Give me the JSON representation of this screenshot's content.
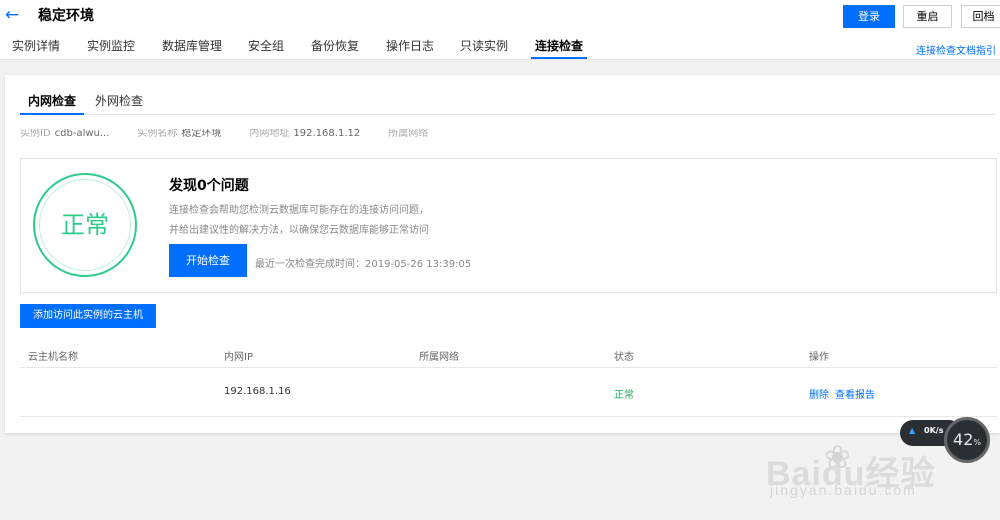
{
  "header": {
    "back_icon": "arrow-left-icon",
    "title": "稳定环境",
    "buttons": {
      "login": "登录",
      "restart": "重启",
      "rollback": "回档"
    },
    "colors": {
      "primary": "#006eff"
    }
  },
  "tabs": [
    "实例详情",
    "实例监控",
    "数据库管理",
    "安全组",
    "备份恢复",
    "操作日志",
    "只读实例",
    "连接检查"
  ],
  "active_tab": "连接检查",
  "doc_link": "连接检查文档指引",
  "subtabs": [
    "内网检查",
    "外网检查"
  ],
  "active_subtab": "内网检查",
  "faded_info": {
    "instance_id_label": "实例ID",
    "instance_id_value": "cdb-alwu...",
    "name_label": "实例名称",
    "name_value": "稳定环境",
    "ip_label": "内网地址",
    "ip_value": "192.168.1.12",
    "net_label": "所属网络"
  },
  "result": {
    "status_icon": "status-normal-circle",
    "status_text": "正常",
    "status_color": "#2ecb8b",
    "title": "发现0个问题",
    "desc1": "连接检查会帮助您检测云数据库可能存在的连接访问问题，",
    "desc2": "并给出建议性的解决方法，以确保您云数据库能够正常访问",
    "start_button": "开始检查",
    "last_check": "最近一次检查完成时间：2019-05-26 13:39:05"
  },
  "add_button": "添加访问此实例的云主机",
  "table": {
    "columns": [
      "云主机名称",
      "内网IP",
      "所属网络",
      "状态",
      "操作"
    ],
    "rows": [
      {
        "name": "",
        "ip": "192.168.1.16",
        "network": "",
        "status": "正常",
        "actions": [
          "删除",
          "查看报告"
        ]
      }
    ]
  },
  "speed_widget": {
    "rate": "0K/s",
    "percent": "42",
    "percent_unit": "%"
  },
  "watermark": {
    "main": "Baidu经验",
    "sub": "jingyan.baidu.com",
    "icon": "baidu-paw-icon"
  }
}
